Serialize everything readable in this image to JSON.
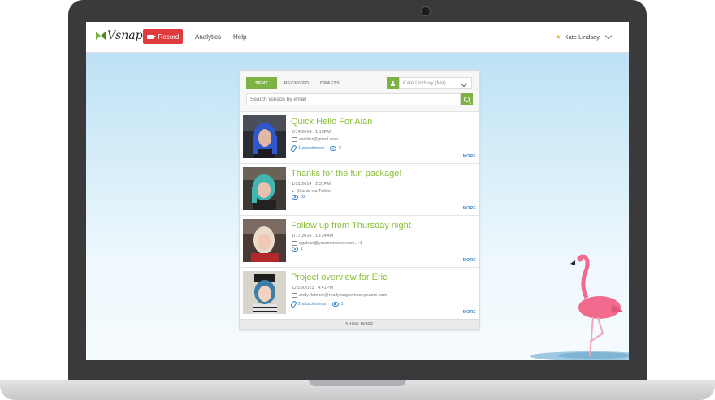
{
  "app": {
    "logo_text": "Vsnap",
    "record_label": "Record",
    "nav": [
      "Analytics",
      "Help"
    ],
    "user_name": "Kate Lindsay",
    "accent_color": "#7cb342",
    "record_color": "#e0393e"
  },
  "panel": {
    "tabs": [
      "SENT",
      "RECEIVED",
      "DRAFTS"
    ],
    "active_tab": "SENT",
    "user_select": "Kate Lindsay (Me)",
    "search_placeholder": "Search vsnaps by email",
    "show_more_label": "SHOW MORE",
    "more_label": "MORE"
  },
  "items": [
    {
      "title": "Quick Hello For Alan",
      "date": "2/14/2014",
      "time": "1:15PM",
      "recipient": "awilder@gmail.com",
      "recipient_icon": "envelope-icon",
      "attachments": "1 attachment",
      "views": "2"
    },
    {
      "title": "Thanks for the fun package!",
      "date": "1/31/2014",
      "time": "2:31PM",
      "recipient": "Shanid via Twitter",
      "recipient_icon": "twitter-icon",
      "attachments": "",
      "views": "52"
    },
    {
      "title": "Follow up from Thursday night",
      "date": "1/17/2014",
      "time": "10:24AM",
      "recipient": "dgahan@yourcompany.com, +1",
      "recipient_icon": "envelope-icon",
      "attachments": "",
      "views": "1"
    },
    {
      "title": "Project overview for Eric",
      "date": "12/29/2013",
      "time": "4:41PM",
      "recipient": "andy.fletcher@reallylongcompanyname.com",
      "recipient_icon": "envelope-icon",
      "attachments": "2 attachments",
      "views": "1"
    }
  ]
}
